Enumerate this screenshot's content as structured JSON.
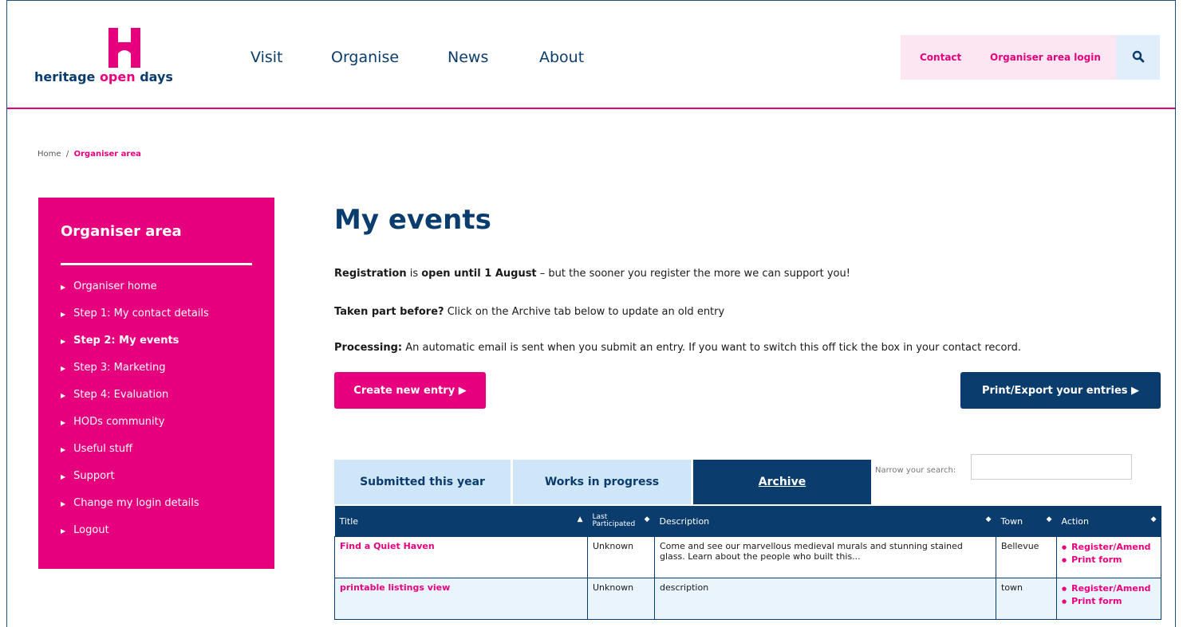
{
  "logo": {
    "text_a": "heritage ",
    "text_b": "open",
    "text_c": " days"
  },
  "nav": [
    "Visit",
    "Organise",
    "News",
    "About"
  ],
  "util": {
    "contact": "Contact",
    "login": "Organiser area login"
  },
  "breadcrumb": {
    "home": "Home",
    "sep": "/",
    "current": "Organiser area"
  },
  "sidebar": {
    "title": "Organiser area",
    "items": [
      "Organiser home",
      "Step 1: My contact details",
      "Step 2: My events",
      "Step 3: Marketing",
      "Step 4: Evaluation",
      "HODs community",
      "Useful stuff",
      "Support",
      "Change my login details",
      "Logout"
    ]
  },
  "main": {
    "title": "My events",
    "p1_b": "Registration",
    "p1_mid": " is ",
    "p1_b2": "open until 1 August",
    "p1_rest": " – but the sooner you register the more we can support you!",
    "p2_b": "Taken part before?",
    "p2_rest": " Click on the Archive tab below to update an old entry",
    "p3_b": "Processing:",
    "p3_rest": " An automatic email is sent when you submit an entry. If you want to switch this off tick the box in your contact record.",
    "create_btn": "Create new entry ▶",
    "export_btn": "Print/Export your entries ▶"
  },
  "tabs": [
    "Submitted this year",
    "Works in progress",
    "Archive"
  ],
  "search": {
    "label": "Narrow your search:"
  },
  "table": {
    "headers": {
      "title": "Title",
      "last_a": "Last",
      "last_b": "Participated",
      "desc": "Description",
      "town": "Town",
      "action": "Action"
    },
    "rows": [
      {
        "title": "Find a Quiet Haven",
        "last": "Unknown",
        "desc": "Come and see our marvellous medieval murals and stunning stained glass. Learn about the people who built this...",
        "town": "Bellevue",
        "act1": "Register/Amend",
        "act2": "Print form"
      },
      {
        "title": "printable listings view",
        "last": "Unknown",
        "desc": "description",
        "town": "town",
        "act1": "Register/Amend",
        "act2": "Print form"
      }
    ]
  },
  "colors": {
    "pink": "#e6007e",
    "navy": "#0a3c6e",
    "light_blue": "#cfe5f8"
  }
}
